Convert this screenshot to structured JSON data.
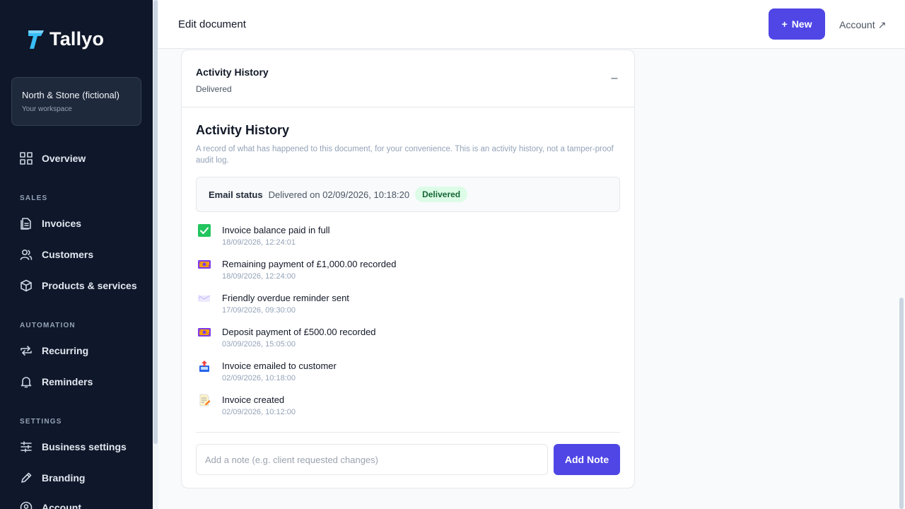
{
  "app": {
    "name": "Tallyo"
  },
  "workspace": {
    "name": "North & Stone (fictional)",
    "subtitle": "Your workspace"
  },
  "sidebar": {
    "overview": "Overview",
    "sections": [
      {
        "title": "SALES",
        "items": [
          "Invoices",
          "Customers",
          "Products & services"
        ]
      },
      {
        "title": "AUTOMATION",
        "items": [
          "Recurring",
          "Reminders"
        ]
      },
      {
        "title": "SETTINGS",
        "items": [
          "Business settings",
          "Branding",
          "Account"
        ]
      }
    ]
  },
  "header": {
    "title": "Edit document",
    "new_label": "New",
    "new_prefix": "+",
    "account_label": "Account",
    "account_icon": "↗"
  },
  "card": {
    "title": "Activity History",
    "subtitle": "Delivered",
    "collapse_symbol": "–",
    "section_title": "Activity History",
    "description": "A record of what has happened to this document, for your convenience. This is an activity history, not a tamper-proof audit log.",
    "email": {
      "label": "Email status",
      "value": "Delivered on 02/09/2026, 10:18:20",
      "badge": "Delivered",
      "badge_color": "#dcfce7"
    },
    "events": [
      {
        "label": "Invoice balance paid in full",
        "time": "18/09/2026, 12:24:01",
        "icon": "check-icon"
      },
      {
        "label": "Remaining payment of £1,000.00 recorded",
        "time": "18/09/2026, 12:24:00",
        "icon": "money-icon"
      },
      {
        "label": "Friendly overdue reminder sent",
        "time": "17/09/2026, 09:30:00",
        "icon": "envelope-icon"
      },
      {
        "label": "Deposit payment of £500.00 recorded",
        "time": "03/09/2026, 15:05:00",
        "icon": "money-icon"
      },
      {
        "label": "Invoice emailed to customer",
        "time": "02/09/2026, 10:18:00",
        "icon": "outbox-icon"
      },
      {
        "label": "Invoice created",
        "time": "02/09/2026, 10:12:00",
        "icon": "memo-icon"
      }
    ],
    "note": {
      "placeholder": "Add a note (e.g. client requested changes)",
      "button": "Add Note"
    }
  },
  "colors": {
    "accent": "#4f46e5",
    "sidebar_bg": "#0f172a",
    "success": "#166534"
  }
}
